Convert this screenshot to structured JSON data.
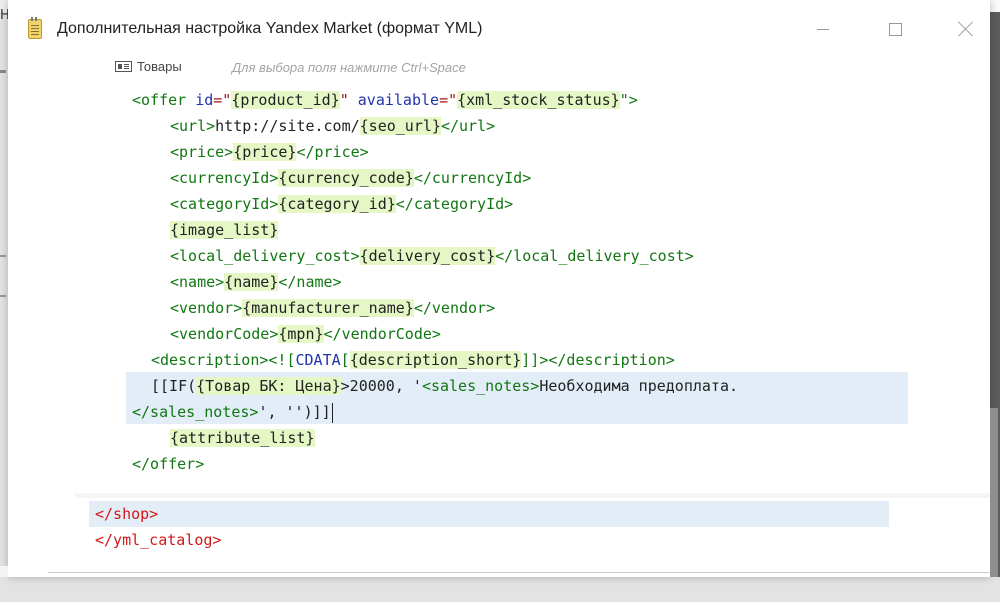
{
  "window": {
    "title": "Дополнительная настройка Yandex Market (формат YML)"
  },
  "toolbar": {
    "products_label": "Товары",
    "hint": "Для выбора поля нажмите Ctrl+Space"
  },
  "background": {
    "letter": "Н"
  },
  "code": {
    "l1": {
      "a": "<offer ",
      "b": "id",
      "c": "=\"",
      "d": "{product_id}",
      "e": "\" ",
      "f": "available",
      "g": "=\"",
      "h": "{xml_stock_status}",
      "i": "\">"
    },
    "l2": {
      "a": "<url>",
      "b": "http://site.com/",
      "c": "{seo_url}",
      "d": "</url>"
    },
    "l3": {
      "a": "<price>",
      "b": "{price}",
      "c": "</price>"
    },
    "l4": {
      "a": "<currencyId>",
      "b": "{currency_code}",
      "c": "</currencyId>"
    },
    "l5": {
      "a": "<categoryId>",
      "b": "{category_id}",
      "c": "</categoryId>"
    },
    "l6": {
      "a": "{image_list}"
    },
    "l7": {
      "a": "<local_delivery_cost>",
      "b": "{delivery_cost}",
      "c": "</local_delivery_cost>"
    },
    "l8": {
      "a": "<name>",
      "b": "{name}",
      "c": "</name>"
    },
    "l9": {
      "a": "<vendor>",
      "b": "{manufacturer_name}",
      "c": "</vendor>"
    },
    "l10": {
      "a": "<vendorCode>",
      "b": "{mpn}",
      "c": "</vendorCode>"
    },
    "l11": {
      "a": "<description>",
      "b": "<![",
      "c": "CDATA",
      "d": "[",
      "e": "{description_short}",
      "f": "]]>",
      "g": "</description>"
    },
    "l12": {
      "a": "[[IF(",
      "b": "{Товар БК: Цена}",
      "c": ">20000, '",
      "d": "<sales_notes>",
      "e": "Необходима предоплата."
    },
    "l13": {
      "a": "</sales_notes>",
      "b": "', '')]]"
    },
    "l14": {
      "a": "{attribute_list}"
    },
    "l15": {
      "a": "</offer>"
    },
    "l16": {
      "a": "</shop>"
    },
    "l17": {
      "a": "</yml_catalog>"
    }
  },
  "colors": {
    "tag": "#117711",
    "attribute": "#2233aa",
    "string": "#a21414",
    "variable_bg": "#e6f7c6",
    "closing_root": "#d31717",
    "current_line": "#e3edf7"
  }
}
